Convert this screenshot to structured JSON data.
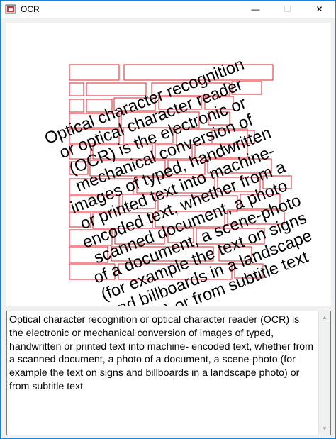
{
  "window": {
    "title": "OCR",
    "minimize_glyph": "—",
    "maximize_glyph": "☐",
    "close_glyph": "✕",
    "app_icon": "ocr-app-icon"
  },
  "image": {
    "lines": [
      "Optical character recognition",
      "or optical character reader",
      "(OCR) is the electronic or",
      "mechanical conversion of",
      "images of typed, handwritten",
      "or printed text into machine-",
      "encoded text, whether from a",
      "scanned document, a photo",
      "of a document, a scene-photo",
      "(for example the text on signs",
      "and billboards in a landscape",
      "photo) or from subtitle text"
    ],
    "text_color": "#000000",
    "box_color": "#e0202a"
  },
  "result": {
    "text": "Optical character recognition or optical character reader (OCR) is the electronic or mechanical conversion of images of typed, handwritten or printed text into machine- encoded text, whether from a scanned document, a photo of a document, a scene-photo (for example the text on signs and billboards in a landscape photo) or from subtitle text"
  },
  "scrollbar": {
    "up_glyph": "▲",
    "down_glyph": "▼"
  }
}
